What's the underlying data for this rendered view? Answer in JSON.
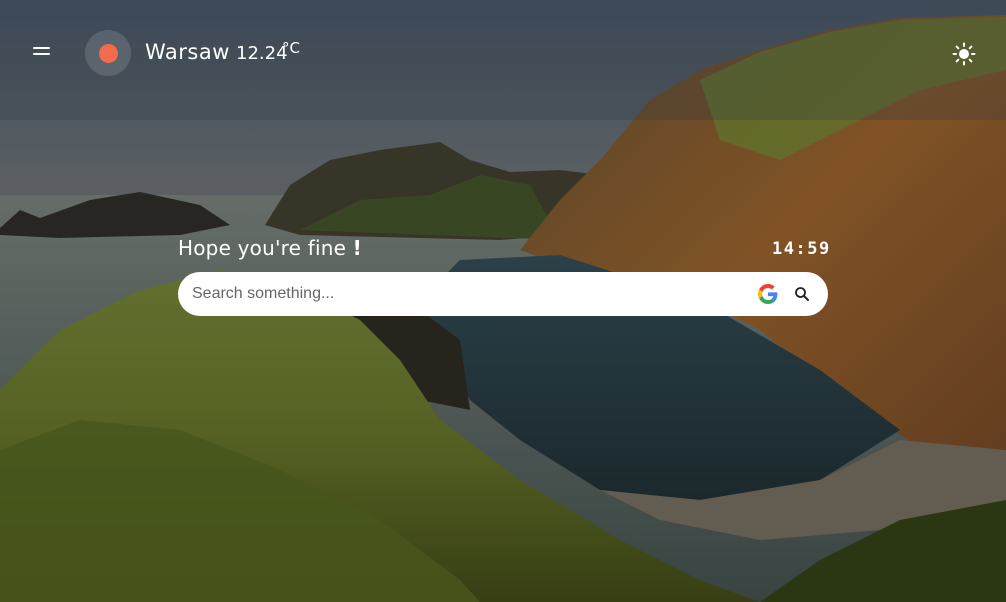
{
  "weather": {
    "city": "Warsaw",
    "temperature": "12.24",
    "unit": "°C",
    "icon": "sun-icon",
    "icon_color": "#f26b4d"
  },
  "greeting": {
    "text": "Hope you're fine",
    "punct": "!"
  },
  "clock": {
    "time": "14:59"
  },
  "search": {
    "placeholder": "Search something...",
    "value": ""
  },
  "icons": {
    "menu": "menu-icon",
    "theme": "sun-brightness-icon",
    "google": "google-icon",
    "search": "search-icon"
  }
}
